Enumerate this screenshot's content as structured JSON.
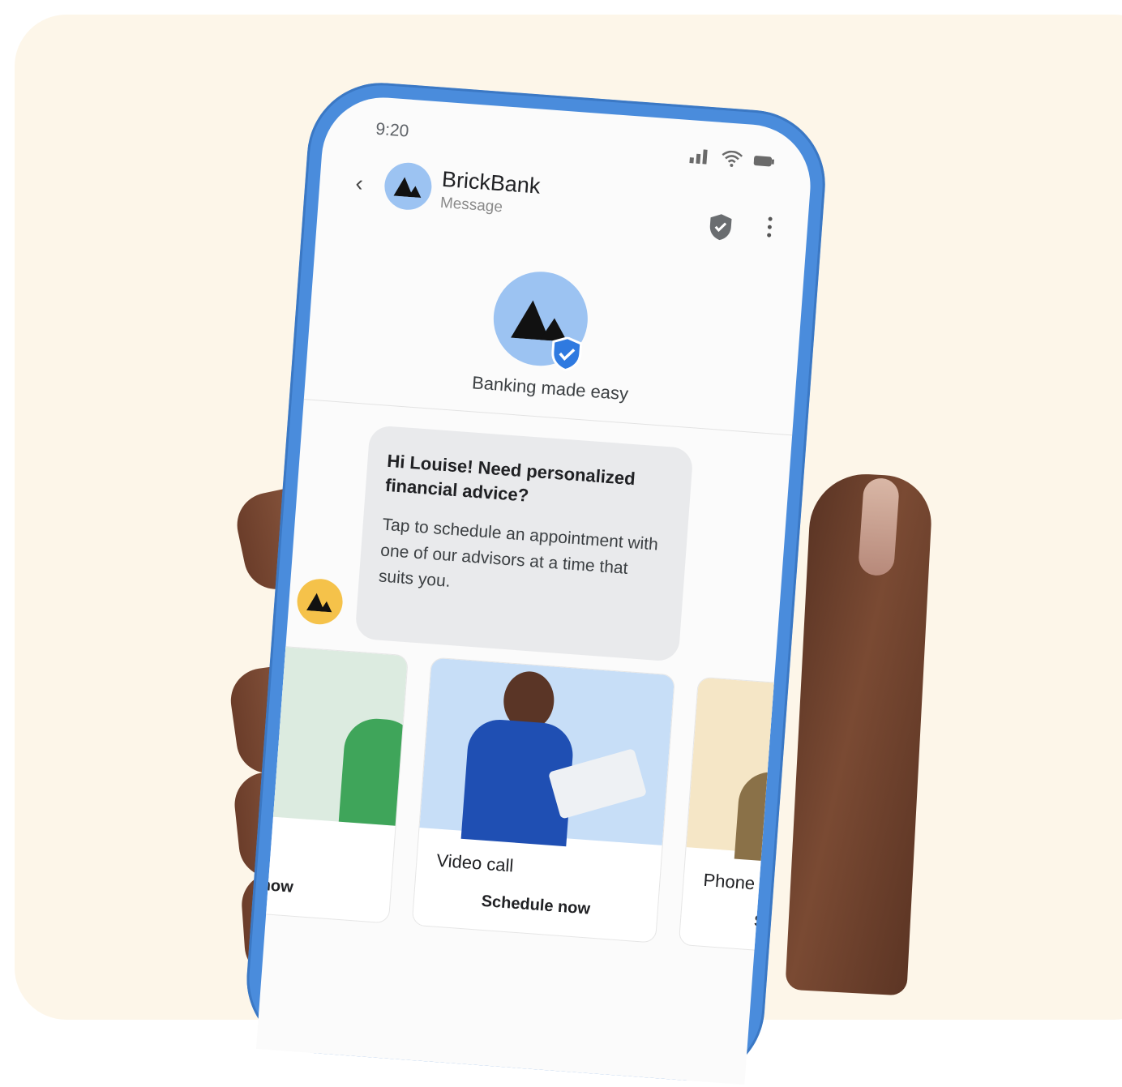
{
  "status_bar": {
    "time": "9:20"
  },
  "header": {
    "title": "BrickBank",
    "subtitle": "Message"
  },
  "profile": {
    "tagline": "Banking made easy"
  },
  "message": {
    "title": "Hi Louise! Need personalized financial advice?",
    "body": "Tap to schedule an appointment with one of our advisors at a time that suits you."
  },
  "cards": [
    {
      "title": "",
      "action": "now",
      "image_color": "#dcebe0"
    },
    {
      "title": "Video call",
      "action": "Schedule now",
      "image_color": "#c7def7"
    },
    {
      "title": "Phone ca",
      "action": "Sc",
      "image_color": "#f5e6c6"
    }
  ],
  "colors": {
    "background": "#fdf6e9",
    "phone_frame": "#4a8cdc",
    "avatar": "#9cc3f2",
    "bot_avatar": "#f5c24a",
    "bubble": "#e9eaec"
  }
}
